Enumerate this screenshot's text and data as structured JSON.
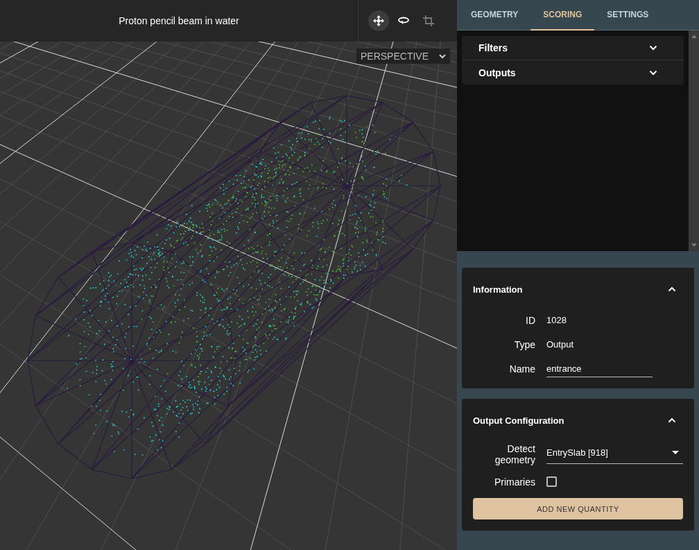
{
  "viewer": {
    "title": "Proton pencil beam in water",
    "tools": [
      {
        "kind": "move",
        "selected": true,
        "disabled": false
      },
      {
        "kind": "rotate",
        "selected": false,
        "disabled": false
      },
      {
        "kind": "crop",
        "selected": false,
        "disabled": true
      }
    ],
    "projection": {
      "value": "PERSPECTIVE"
    }
  },
  "tabs": [
    {
      "label": "GEOMETRY",
      "selected": false
    },
    {
      "label": "SCORING",
      "selected": true
    },
    {
      "label": "SETTINGS",
      "selected": false
    }
  ],
  "accordions": [
    {
      "title": "Filters",
      "expanded": false
    },
    {
      "title": "Outputs",
      "expanded": false
    }
  ],
  "cards": [
    {
      "title": "Information",
      "expanded": true,
      "fields": [
        {
          "kind": "text",
          "label": "ID",
          "value": "1028"
        },
        {
          "kind": "text",
          "label": "Type",
          "value": "Output"
        },
        {
          "kind": "input",
          "label": "Name",
          "value": "entrance"
        }
      ]
    },
    {
      "title": "Output Configuration",
      "expanded": true,
      "fields": [
        {
          "kind": "select",
          "label": "Detect geometry",
          "value": "EntrySlab [918]"
        },
        {
          "kind": "checkbox",
          "label": "Primaries",
          "checked": false
        }
      ],
      "button": "ADD NEW QUANTITY"
    }
  ]
}
